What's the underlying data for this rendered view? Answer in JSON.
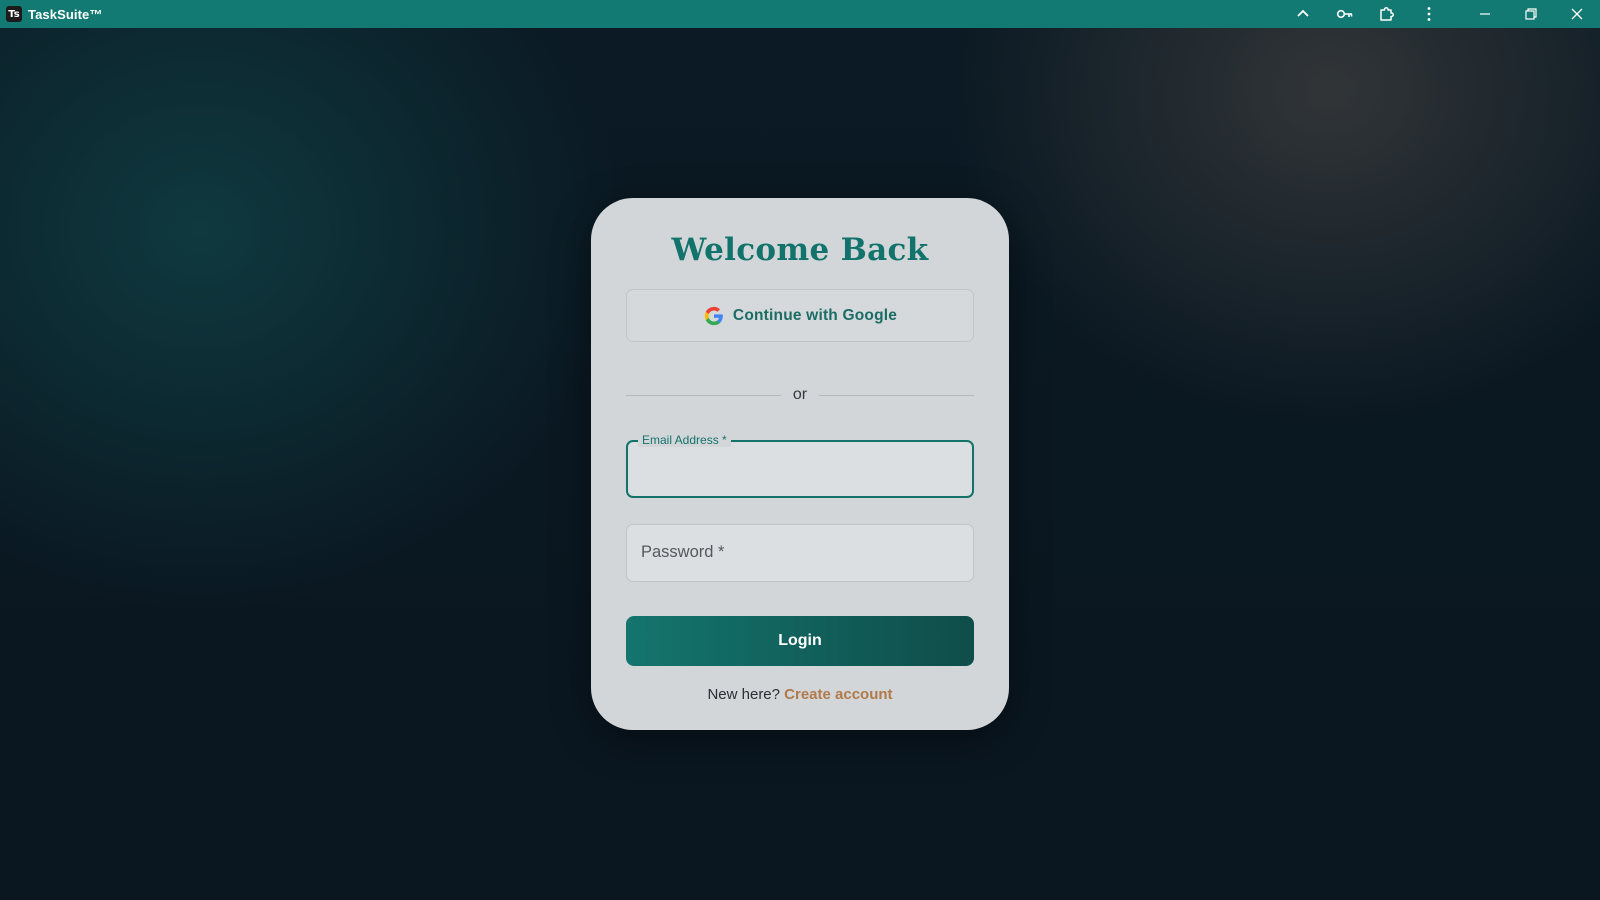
{
  "window": {
    "app_logo_text": "Ts",
    "title": "TaskSuite™",
    "icons": [
      "chevron-up-icon",
      "key-icon",
      "extension-icon",
      "more-vert-icon",
      "minimize-icon",
      "restore-icon",
      "close-icon"
    ]
  },
  "card": {
    "title": "Welcome Back",
    "google_button_label": "Continue with Google",
    "divider_text": "or",
    "email_label": "Email Address *",
    "email_value": "",
    "password_placeholder": "Password *",
    "login_button_label": "Login",
    "footer_prompt": "New here?",
    "create_account_label": "Create account"
  },
  "colors": {
    "titlebar": "#127a72",
    "accent": "#13736b",
    "link": "#b07a4b",
    "card_background": "#d3d6d8"
  }
}
